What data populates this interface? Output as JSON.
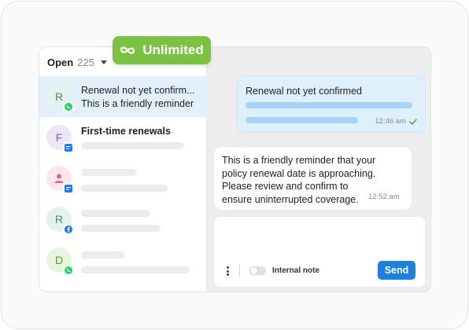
{
  "badge": {
    "label": "Unlimited",
    "icon": "infinity-icon",
    "color": "#7cc242"
  },
  "inbox": {
    "open_label": "Open",
    "open_count": "225"
  },
  "conversations": [
    {
      "avatar_letter": "R",
      "avatar_bg": "#e4f1ec",
      "avatar_fg": "#4a8a72",
      "channel": "whatsapp-icon",
      "title": "Renewal not yet confirm...",
      "subtitle": "This is a friendly reminder"
    },
    {
      "avatar_letter": "F",
      "avatar_bg": "#ece6f5",
      "avatar_fg": "#7a6aa0",
      "channel": "chat-icon",
      "title": "First-time renewals"
    },
    {
      "avatar_letter": "",
      "avatar_bg": "#fbe7ec",
      "avatar_fg": "#d76a86",
      "channel": "chat-icon"
    },
    {
      "avatar_letter": "R",
      "avatar_bg": "#e4f1ec",
      "avatar_fg": "#4a8a72",
      "channel": "facebook-icon"
    },
    {
      "avatar_letter": "D",
      "avatar_bg": "#e7f4de",
      "avatar_fg": "#5c9a3c",
      "channel": "whatsapp-icon"
    }
  ],
  "chat": {
    "incoming": {
      "text": "Renewal not yet confirmed",
      "time": "12:46 am"
    },
    "outgoing": {
      "lines": [
        "This is a friendly reminder that your",
        "policy renewal date is approaching.",
        "Please review and confirm to",
        "ensure uninterrupted coverage."
      ],
      "time": "12:52 am"
    }
  },
  "composer": {
    "internal_note_label": "Internal note",
    "send_label": "Send"
  },
  "colors": {
    "accent": "#1e7fe0",
    "whatsapp": "#25d366",
    "facebook": "#1877f2",
    "chat": "#1e7fe0"
  }
}
